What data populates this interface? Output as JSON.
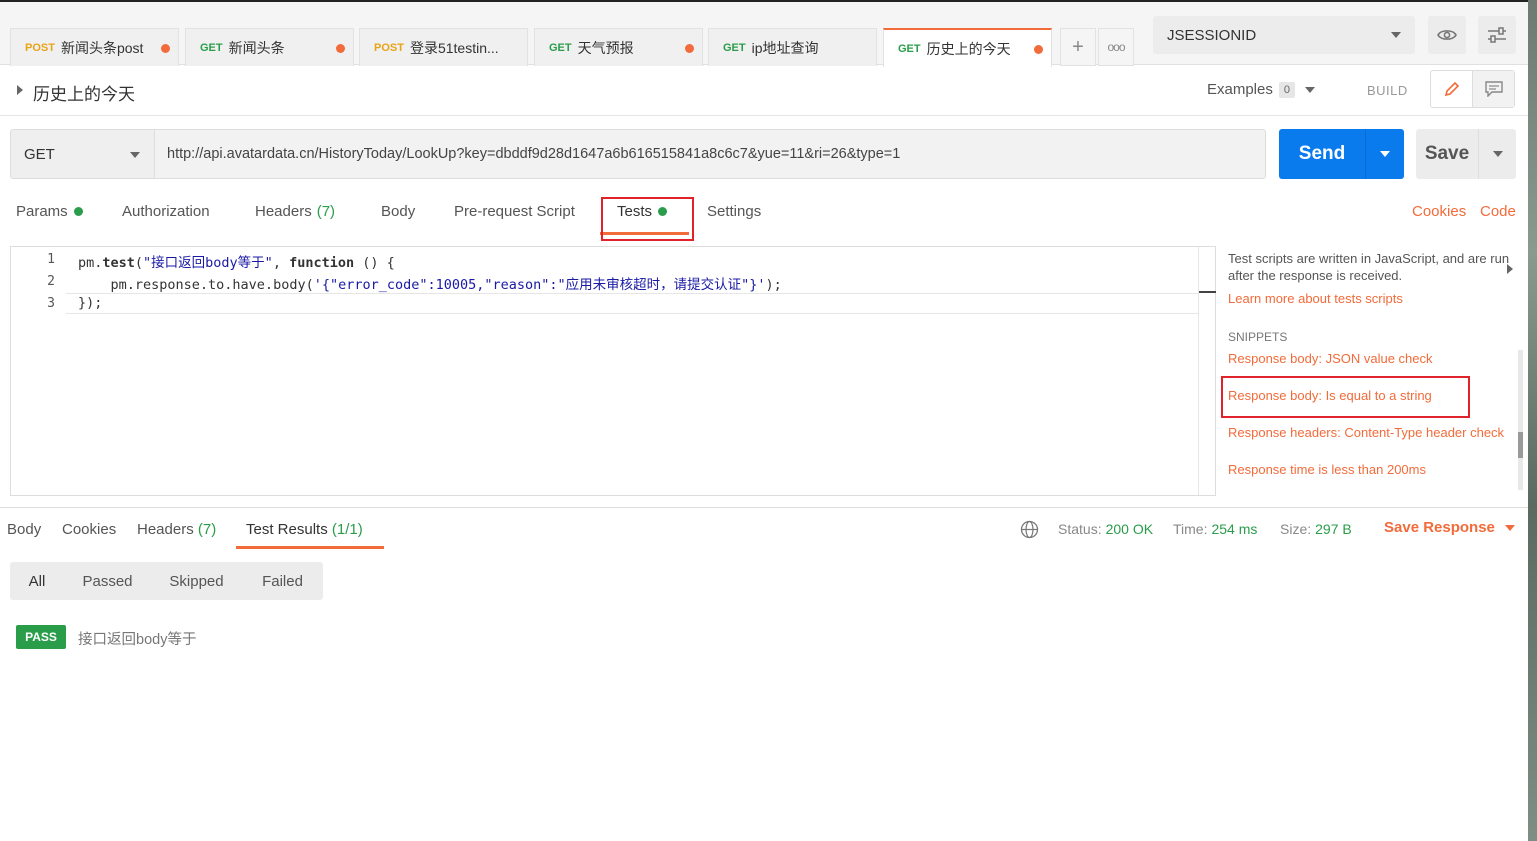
{
  "tabs": [
    {
      "method": "POST",
      "label": "新闻头条post",
      "unsaved": true
    },
    {
      "method": "GET",
      "label": "新闻头条",
      "unsaved": true
    },
    {
      "method": "POST",
      "label": "登录51testin...",
      "unsaved": false
    },
    {
      "method": "GET",
      "label": "天气预报",
      "unsaved": true
    },
    {
      "method": "GET",
      "label": "ip地址查询",
      "unsaved": false
    },
    {
      "method": "GET",
      "label": "历史上的今天",
      "unsaved": true,
      "active": true
    }
  ],
  "tabbar": {
    "new_tab": "+",
    "more": "ooo"
  },
  "environment": {
    "selected": "JSESSIONID"
  },
  "request": {
    "title": "历史上的今天",
    "examples_label": "Examples",
    "examples_count": "0",
    "build_label": "BUILD",
    "method": "GET",
    "url": "http://api.avatardata.cn/HistoryToday/LookUp?key=dbddf9d28d1647a6b616515841a8c6c7&yue=11&ri=26&type=1",
    "send_label": "Send",
    "save_label": "Save"
  },
  "subtabs": {
    "params": "Params",
    "authorization": "Authorization",
    "headers": "Headers",
    "headers_count": "(7)",
    "body": "Body",
    "prerequest": "Pre-request Script",
    "tests": "Tests",
    "settings": "Settings",
    "cookies": "Cookies",
    "code": "Code"
  },
  "editor": {
    "line_numbers": [
      "1",
      "2",
      "3"
    ],
    "line1_a": "pm.",
    "line1_b": "test",
    "line1_c": "(",
    "line1_str": "\"接口返回body等于\"",
    "line1_d": ", ",
    "line1_kw": "function",
    "line1_e": " () {",
    "line2_a": "    pm.response.to.have.body(",
    "line2_str": "'{\"error_code\":10005,\"reason\":\"应用未审核超时，请提交认证\"}'",
    "line2_b": ");",
    "line3": "});"
  },
  "snippets_panel": {
    "description": "Test scripts are written in JavaScript, and are run after the response is received.",
    "learn_more": "Learn more about tests scripts",
    "heading": "SNIPPETS",
    "items": [
      "Response body: JSON value check",
      "Response body: Is equal to a string",
      "Response headers: Content-Type header check",
      "Response time is less than 200ms"
    ]
  },
  "response": {
    "tabs": {
      "body": "Body",
      "cookies": "Cookies",
      "headers": "Headers",
      "headers_count": "(7)",
      "test_results": "Test Results",
      "test_results_count": "(1/1)"
    },
    "status_label": "Status:",
    "status_value": "200 OK",
    "time_label": "Time:",
    "time_value": "254 ms",
    "size_label": "Size:",
    "size_value": "297 B",
    "save_response": "Save Response",
    "filters": [
      "All",
      "Passed",
      "Skipped",
      "Failed"
    ],
    "results": [
      {
        "status": "PASS",
        "name": "接口返回body等于"
      }
    ]
  },
  "colors": {
    "accent": "#f26b3a",
    "send": "#097bed",
    "success": "#2a9d4a",
    "highlight": "#e0232b"
  }
}
